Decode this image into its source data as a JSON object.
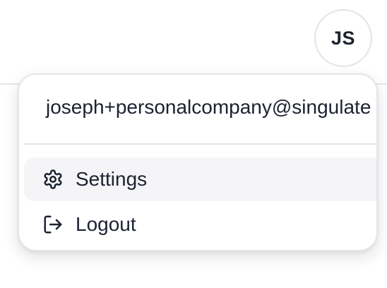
{
  "header": {
    "avatar_initials": "JS"
  },
  "user_menu": {
    "email": "joseph+personalcompany@singulate",
    "items": [
      {
        "label": "Settings",
        "icon": "gear-icon"
      },
      {
        "label": "Logout",
        "icon": "logout-icon"
      }
    ],
    "hover_background": "#f5f5f7"
  },
  "colors": {
    "text": "#1c2230",
    "border": "#e4e5e9"
  }
}
